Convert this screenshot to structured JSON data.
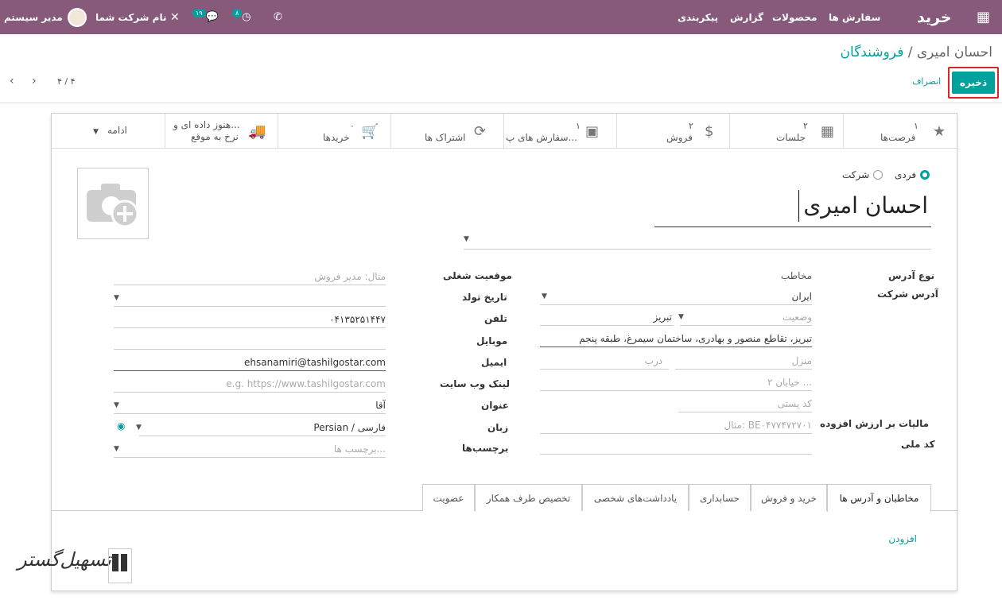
{
  "nav": {
    "app_title": "خرید",
    "menus": [
      "سفارش ها",
      "محصولات",
      "گزارش",
      "پیکربندی"
    ],
    "user_name": "مدیر سیستم",
    "company": "نام شرکت شما",
    "chat_count": "۱۹",
    "activity_count": "۸"
  },
  "breadcrumb": {
    "parent": "فروشندگان",
    "separator": "/",
    "current": "احسان امیری"
  },
  "buttons": {
    "save": "ذخیره",
    "discard": "انصراف"
  },
  "pager": "۴ / ۴",
  "smart_buttons": [
    {
      "num": "۱",
      "label": "فرصت‌ها",
      "icon": "★"
    },
    {
      "num": "۲",
      "label": "جلسات",
      "icon": "▦"
    },
    {
      "num": "۲",
      "label": "فروش",
      "icon": "$"
    },
    {
      "num": "۱",
      "label": "سفارش های پ...",
      "icon": "▣"
    },
    {
      "num": "",
      "label": "اشتراک ها",
      "icon": "⟳"
    },
    {
      "num": "۰",
      "label": "خریدها",
      "icon": "🛒"
    },
    {
      "num": "هنوز داده ای و...",
      "label": "نرخ به موقع",
      "icon": "🚚"
    }
  ],
  "more": "ادامه",
  "company_type": {
    "individual": "فردی",
    "company": "شرکت"
  },
  "partner_name": "احسان امیری",
  "left_labels": {
    "address_type": "نوع آدرس",
    "company_address": "آدرس شرکت",
    "vat": "مالیات بر ارزش افزوده",
    "national_code": "کد ملی"
  },
  "address": {
    "type": "مخاطب",
    "country": "ایران",
    "state": "وضعیت",
    "city": "تبریز",
    "street": "تبریز، تقاطع منصور و بهادری، ساختمان سیمرغ، طبقه پنجم",
    "house": "منزل",
    "door": "درب",
    "street2": "خیابان ۲ ...",
    "zip": "کد پستی",
    "vat_placeholder": "مثال: BE۰۴۷۷۴۷۲۷۰۱"
  },
  "right_labels": {
    "job": "موقعیت شغلی",
    "birth": "تاریخ تولد",
    "phone": "تلفن",
    "mobile": "موبایل",
    "email": "ایمیل",
    "website": "لینک وب سایت",
    "title": "عنوان",
    "lang": "زبان",
    "tags": "برچسب‌ها"
  },
  "right_values": {
    "job_placeholder": "مثال: مدیر فروش",
    "phone": "۰۴۱۳۵۲۵۱۴۴۷",
    "email": "ehsanamiri@tashilgostar.com",
    "website_placeholder": "e.g. https://www.tashilgostar.com",
    "title": "آقا",
    "lang": "Persian / فارسی",
    "tags_placeholder": "برچسب ها..."
  },
  "tabs": [
    "مخاطبان و آدرس ها",
    "خرید و فروش",
    "حسابداری",
    "یادداشت‌های شخصی",
    "تخصیص طرف همکار",
    "عضویت"
  ],
  "add_link": "افزودن",
  "watermark": "تسهیل‌گستر",
  "colors": {
    "navbar": "#875a7b",
    "accent": "#00a09d",
    "highlight": "#e02424"
  }
}
